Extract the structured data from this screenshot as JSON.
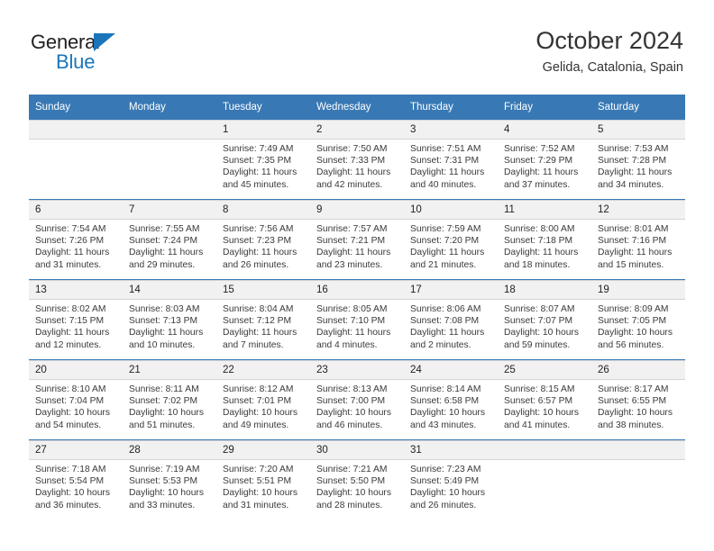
{
  "brand": {
    "name_top": "General",
    "name_bottom": "Blue",
    "accent_color": "#1b75bb"
  },
  "header": {
    "title": "October 2024",
    "subtitle": "Gelida, Catalonia, Spain"
  },
  "theme": {
    "header_blue": "#3879b5",
    "daynum_bg": "#f1f1f1",
    "text": "#3a3a3a"
  },
  "weekday_headers": [
    "Sunday",
    "Monday",
    "Tuesday",
    "Wednesday",
    "Thursday",
    "Friday",
    "Saturday"
  ],
  "labels": {
    "sunrise_prefix": "Sunrise:",
    "sunset_prefix": "Sunset:",
    "daylight_prefix": "Daylight:"
  },
  "weeks": [
    [
      {
        "day": "",
        "empty": true
      },
      {
        "day": "",
        "empty": true
      },
      {
        "day": "1",
        "sunrise": "Sunrise: 7:49 AM",
        "sunset": "Sunset: 7:35 PM",
        "daylight_line1": "Daylight: 11 hours",
        "daylight_line2": "and 45 minutes."
      },
      {
        "day": "2",
        "sunrise": "Sunrise: 7:50 AM",
        "sunset": "Sunset: 7:33 PM",
        "daylight_line1": "Daylight: 11 hours",
        "daylight_line2": "and 42 minutes."
      },
      {
        "day": "3",
        "sunrise": "Sunrise: 7:51 AM",
        "sunset": "Sunset: 7:31 PM",
        "daylight_line1": "Daylight: 11 hours",
        "daylight_line2": "and 40 minutes."
      },
      {
        "day": "4",
        "sunrise": "Sunrise: 7:52 AM",
        "sunset": "Sunset: 7:29 PM",
        "daylight_line1": "Daylight: 11 hours",
        "daylight_line2": "and 37 minutes."
      },
      {
        "day": "5",
        "sunrise": "Sunrise: 7:53 AM",
        "sunset": "Sunset: 7:28 PM",
        "daylight_line1": "Daylight: 11 hours",
        "daylight_line2": "and 34 minutes."
      }
    ],
    [
      {
        "day": "6",
        "sunrise": "Sunrise: 7:54 AM",
        "sunset": "Sunset: 7:26 PM",
        "daylight_line1": "Daylight: 11 hours",
        "daylight_line2": "and 31 minutes."
      },
      {
        "day": "7",
        "sunrise": "Sunrise: 7:55 AM",
        "sunset": "Sunset: 7:24 PM",
        "daylight_line1": "Daylight: 11 hours",
        "daylight_line2": "and 29 minutes."
      },
      {
        "day": "8",
        "sunrise": "Sunrise: 7:56 AM",
        "sunset": "Sunset: 7:23 PM",
        "daylight_line1": "Daylight: 11 hours",
        "daylight_line2": "and 26 minutes."
      },
      {
        "day": "9",
        "sunrise": "Sunrise: 7:57 AM",
        "sunset": "Sunset: 7:21 PM",
        "daylight_line1": "Daylight: 11 hours",
        "daylight_line2": "and 23 minutes."
      },
      {
        "day": "10",
        "sunrise": "Sunrise: 7:59 AM",
        "sunset": "Sunset: 7:20 PM",
        "daylight_line1": "Daylight: 11 hours",
        "daylight_line2": "and 21 minutes."
      },
      {
        "day": "11",
        "sunrise": "Sunrise: 8:00 AM",
        "sunset": "Sunset: 7:18 PM",
        "daylight_line1": "Daylight: 11 hours",
        "daylight_line2": "and 18 minutes."
      },
      {
        "day": "12",
        "sunrise": "Sunrise: 8:01 AM",
        "sunset": "Sunset: 7:16 PM",
        "daylight_line1": "Daylight: 11 hours",
        "daylight_line2": "and 15 minutes."
      }
    ],
    [
      {
        "day": "13",
        "sunrise": "Sunrise: 8:02 AM",
        "sunset": "Sunset: 7:15 PM",
        "daylight_line1": "Daylight: 11 hours",
        "daylight_line2": "and 12 minutes."
      },
      {
        "day": "14",
        "sunrise": "Sunrise: 8:03 AM",
        "sunset": "Sunset: 7:13 PM",
        "daylight_line1": "Daylight: 11 hours",
        "daylight_line2": "and 10 minutes."
      },
      {
        "day": "15",
        "sunrise": "Sunrise: 8:04 AM",
        "sunset": "Sunset: 7:12 PM",
        "daylight_line1": "Daylight: 11 hours",
        "daylight_line2": "and 7 minutes."
      },
      {
        "day": "16",
        "sunrise": "Sunrise: 8:05 AM",
        "sunset": "Sunset: 7:10 PM",
        "daylight_line1": "Daylight: 11 hours",
        "daylight_line2": "and 4 minutes."
      },
      {
        "day": "17",
        "sunrise": "Sunrise: 8:06 AM",
        "sunset": "Sunset: 7:08 PM",
        "daylight_line1": "Daylight: 11 hours",
        "daylight_line2": "and 2 minutes."
      },
      {
        "day": "18",
        "sunrise": "Sunrise: 8:07 AM",
        "sunset": "Sunset: 7:07 PM",
        "daylight_line1": "Daylight: 10 hours",
        "daylight_line2": "and 59 minutes."
      },
      {
        "day": "19",
        "sunrise": "Sunrise: 8:09 AM",
        "sunset": "Sunset: 7:05 PM",
        "daylight_line1": "Daylight: 10 hours",
        "daylight_line2": "and 56 minutes."
      }
    ],
    [
      {
        "day": "20",
        "sunrise": "Sunrise: 8:10 AM",
        "sunset": "Sunset: 7:04 PM",
        "daylight_line1": "Daylight: 10 hours",
        "daylight_line2": "and 54 minutes."
      },
      {
        "day": "21",
        "sunrise": "Sunrise: 8:11 AM",
        "sunset": "Sunset: 7:02 PM",
        "daylight_line1": "Daylight: 10 hours",
        "daylight_line2": "and 51 minutes."
      },
      {
        "day": "22",
        "sunrise": "Sunrise: 8:12 AM",
        "sunset": "Sunset: 7:01 PM",
        "daylight_line1": "Daylight: 10 hours",
        "daylight_line2": "and 49 minutes."
      },
      {
        "day": "23",
        "sunrise": "Sunrise: 8:13 AM",
        "sunset": "Sunset: 7:00 PM",
        "daylight_line1": "Daylight: 10 hours",
        "daylight_line2": "and 46 minutes."
      },
      {
        "day": "24",
        "sunrise": "Sunrise: 8:14 AM",
        "sunset": "Sunset: 6:58 PM",
        "daylight_line1": "Daylight: 10 hours",
        "daylight_line2": "and 43 minutes."
      },
      {
        "day": "25",
        "sunrise": "Sunrise: 8:15 AM",
        "sunset": "Sunset: 6:57 PM",
        "daylight_line1": "Daylight: 10 hours",
        "daylight_line2": "and 41 minutes."
      },
      {
        "day": "26",
        "sunrise": "Sunrise: 8:17 AM",
        "sunset": "Sunset: 6:55 PM",
        "daylight_line1": "Daylight: 10 hours",
        "daylight_line2": "and 38 minutes."
      }
    ],
    [
      {
        "day": "27",
        "sunrise": "Sunrise: 7:18 AM",
        "sunset": "Sunset: 5:54 PM",
        "daylight_line1": "Daylight: 10 hours",
        "daylight_line2": "and 36 minutes."
      },
      {
        "day": "28",
        "sunrise": "Sunrise: 7:19 AM",
        "sunset": "Sunset: 5:53 PM",
        "daylight_line1": "Daylight: 10 hours",
        "daylight_line2": "and 33 minutes."
      },
      {
        "day": "29",
        "sunrise": "Sunrise: 7:20 AM",
        "sunset": "Sunset: 5:51 PM",
        "daylight_line1": "Daylight: 10 hours",
        "daylight_line2": "and 31 minutes."
      },
      {
        "day": "30",
        "sunrise": "Sunrise: 7:21 AM",
        "sunset": "Sunset: 5:50 PM",
        "daylight_line1": "Daylight: 10 hours",
        "daylight_line2": "and 28 minutes."
      },
      {
        "day": "31",
        "sunrise": "Sunrise: 7:23 AM",
        "sunset": "Sunset: 5:49 PM",
        "daylight_line1": "Daylight: 10 hours",
        "daylight_line2": "and 26 minutes."
      },
      {
        "day": "",
        "empty": true
      },
      {
        "day": "",
        "empty": true
      }
    ]
  ]
}
